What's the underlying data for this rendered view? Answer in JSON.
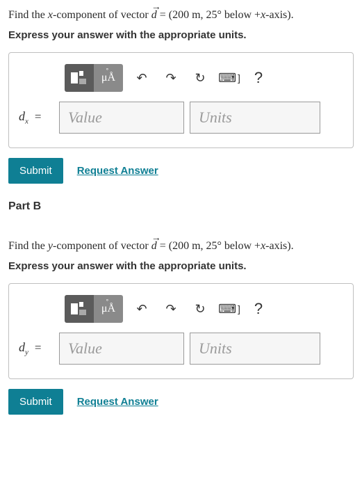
{
  "partA": {
    "question_pre": "Find the ",
    "question_var": "x",
    "question_mid": "-component of vector ",
    "vector_letter": "d",
    "question_post": " = (200 m, 25° below +",
    "axis_var": "x",
    "question_end": "-axis).",
    "sub_instruction": "Express your answer with the appropriate units.",
    "toolbar": {
      "units_label": "μÅ",
      "undo_glyph": "↶",
      "redo_glyph": "↷",
      "reset_glyph": "↻",
      "keyboard_glyph": "⌨",
      "help_glyph": "?"
    },
    "lhs_var": "d",
    "lhs_sub": "x",
    "eq": "=",
    "value_placeholder": "Value",
    "units_placeholder": "Units",
    "submit_label": "Submit",
    "request_label": "Request Answer"
  },
  "partB_header": "Part B",
  "partB": {
    "question_pre": "Find the ",
    "question_var": "y",
    "question_mid": "-component of vector ",
    "vector_letter": "d",
    "question_post": " = (200 m, 25° below +",
    "axis_var": "x",
    "question_end": "-axis).",
    "sub_instruction": "Express your answer with the appropriate units.",
    "toolbar": {
      "units_label": "μÅ",
      "undo_glyph": "↶",
      "redo_glyph": "↷",
      "reset_glyph": "↻",
      "keyboard_glyph": "⌨",
      "help_glyph": "?"
    },
    "lhs_var": "d",
    "lhs_sub": "y",
    "eq": "=",
    "value_placeholder": "Value",
    "units_placeholder": "Units",
    "submit_label": "Submit",
    "request_label": "Request Answer"
  }
}
